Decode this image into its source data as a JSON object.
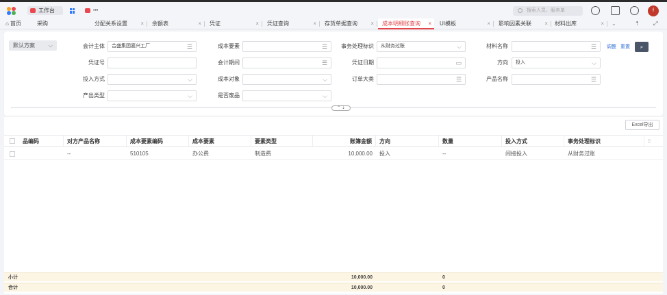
{
  "header": {
    "workspace_label": "工作台",
    "more_label": "•••",
    "search_placeholder": "搜索人员、服务单",
    "avatar_text": "f"
  },
  "tabs": [
    {
      "label": "⌂ 首页",
      "closable": false
    },
    {
      "label": "采购",
      "closable": false
    },
    {
      "label": "分配关系设置",
      "closable": true
    },
    {
      "label": "余额表",
      "closable": true
    },
    {
      "label": "凭证",
      "closable": true
    },
    {
      "label": "凭证查询",
      "closable": true
    },
    {
      "label": "存货单据查询",
      "closable": true
    },
    {
      "label": "成本明细账查询",
      "closable": true,
      "active": true
    },
    {
      "label": "UI模板",
      "closable": true
    },
    {
      "label": "影响因素关联",
      "closable": true
    },
    {
      "label": "材料出库",
      "closable": true
    }
  ],
  "filter": {
    "scheme_label": "默认方案",
    "fields": {
      "accounting_entity": {
        "label": "会计主体",
        "value": "合盛集团嘉兴工厂"
      },
      "cost_element": {
        "label": "成本要素",
        "value": ""
      },
      "business_flag": {
        "label": "事务处理标识",
        "value": "从财务过账"
      },
      "material_name": {
        "label": "材料名称",
        "value": ""
      },
      "voucher_no": {
        "label": "凭证号",
        "value": ""
      },
      "period": {
        "label": "会计期间",
        "value": ""
      },
      "voucher_date": {
        "label": "凭证日期",
        "value": ""
      },
      "direction": {
        "label": "方向",
        "value": "投入"
      },
      "input_method": {
        "label": "投入方式",
        "value": ""
      },
      "cost_object": {
        "label": "成本对象",
        "value": ""
      },
      "order_category": {
        "label": "订单大类",
        "value": ""
      },
      "product_name": {
        "label": "产品名称",
        "value": ""
      },
      "output_type": {
        "label": "产出类型",
        "value": ""
      },
      "is_scrap": {
        "label": "是否废品",
        "value": ""
      }
    },
    "adjust_label": "调整",
    "reset_label": "重置"
  },
  "table": {
    "export_label": "Excel导出",
    "columns": [
      "品编码",
      "对方产品名称",
      "成本要素编码",
      "成本要素",
      "要素类型",
      "账簿金额",
      "方向",
      "数量",
      "投入方式",
      "事务处理标识"
    ],
    "rows": [
      [
        "",
        "--",
        "510105",
        "办公费",
        "制造费",
        "10,000.00",
        "投入",
        "--",
        "间接投入",
        "从财务过账"
      ]
    ],
    "subtotal": {
      "label": "小计",
      "amount": "10,000.00",
      "qty": "0"
    },
    "total": {
      "label": "合计",
      "amount": "10,000.00",
      "qty": "0"
    }
  },
  "colors": {
    "accent": "#e0464b",
    "link": "#2f6fd9",
    "footer_bg": "#fdf5e3"
  }
}
